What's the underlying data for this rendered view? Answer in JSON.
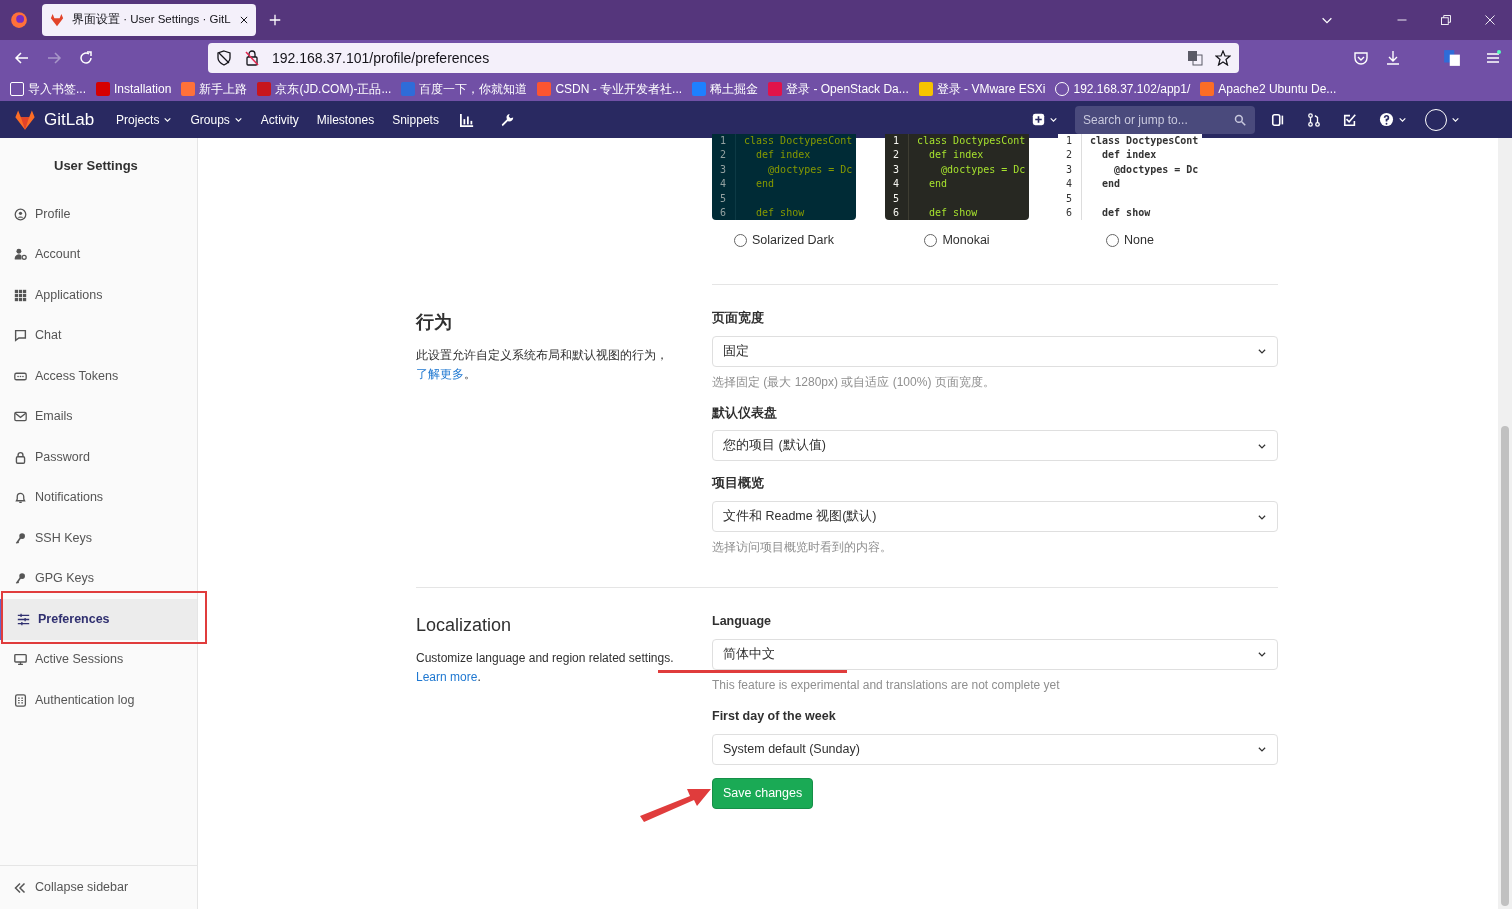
{
  "browser": {
    "tab_title": "界面设置 · User Settings · GitL",
    "url": "192.168.37.101/profile/preferences",
    "bookmarks": [
      {
        "label": "导入书签..."
      },
      {
        "label": "Installation"
      },
      {
        "label": "新手上路"
      },
      {
        "label": "京东(JD.COM)-正品..."
      },
      {
        "label": "百度一下，你就知道"
      },
      {
        "label": "CSDN - 专业开发者社..."
      },
      {
        "label": "稀土掘金"
      },
      {
        "label": "登录 - OpenStack Da..."
      },
      {
        "label": "登录 - VMware ESXi"
      },
      {
        "label": "192.168.37.102/app1/"
      },
      {
        "label": "Apache2 Ubuntu De..."
      }
    ]
  },
  "topnav": {
    "brand": "GitLab",
    "menu": [
      {
        "label": "Projects",
        "dropdown": true
      },
      {
        "label": "Groups",
        "dropdown": true
      },
      {
        "label": "Activity",
        "dropdown": false
      },
      {
        "label": "Milestones",
        "dropdown": false
      },
      {
        "label": "Snippets",
        "dropdown": false
      }
    ],
    "search_placeholder": "Search or jump to..."
  },
  "sidebar": {
    "title": "User Settings",
    "items": [
      {
        "label": "Profile",
        "selected": false
      },
      {
        "label": "Account",
        "selected": false
      },
      {
        "label": "Applications",
        "selected": false
      },
      {
        "label": "Chat",
        "selected": false
      },
      {
        "label": "Access Tokens",
        "selected": false
      },
      {
        "label": "Emails",
        "selected": false
      },
      {
        "label": "Password",
        "selected": false
      },
      {
        "label": "Notifications",
        "selected": false
      },
      {
        "label": "SSH Keys",
        "selected": false
      },
      {
        "label": "GPG Keys",
        "selected": false
      },
      {
        "label": "Preferences",
        "selected": true
      },
      {
        "label": "Active Sessions",
        "selected": false
      },
      {
        "label": "Authentication log",
        "selected": false
      }
    ],
    "collapse_label": "Collapse sidebar"
  },
  "syntax_themes": [
    {
      "name": "Solarized Dark",
      "kind": "solarized",
      "selected": false,
      "lines": [
        {
          "number": "1",
          "code": "class DoctypesCont"
        },
        {
          "number": "2",
          "code": "  def index"
        },
        {
          "number": "3",
          "code": "    @doctypes = Dc"
        },
        {
          "number": "4",
          "code": "  end"
        },
        {
          "number": "5"
        },
        {
          "number": "6",
          "code": "  def show"
        }
      ]
    },
    {
      "name": "Monokai",
      "kind": "monokai",
      "selected": false,
      "lines": [
        {
          "number": "1",
          "code": "class DoctypesCont"
        },
        {
          "number": "2",
          "code": "  def index"
        },
        {
          "number": "3",
          "code": "    @doctypes = Dc"
        },
        {
          "number": "4",
          "code": "  end"
        },
        {
          "number": "5"
        },
        {
          "number": "6",
          "code": "  def show"
        }
      ]
    },
    {
      "name": "None",
      "kind": "none",
      "selected": false,
      "lines": [
        {
          "number": "1",
          "code": "class DoctypesCont"
        },
        {
          "number": "2",
          "code": "  def index"
        },
        {
          "number": "3",
          "code": "    @doctypes = Dc"
        },
        {
          "number": "4",
          "code": "  end"
        },
        {
          "number": "5"
        },
        {
          "number": "6",
          "code": "  def show"
        }
      ]
    }
  ],
  "sections": [
    {
      "title": "行为",
      "description": "此设置允许自定义系统布局和默认视图的行为，",
      "link": "了解更多",
      "link_suffix": "。",
      "fields": [
        {
          "label": "页面宽度",
          "value": "固定",
          "help": "选择固定 (最大 1280px) 或自适应 (100%) 页面宽度。"
        },
        {
          "label": "默认仪表盘",
          "value": "您的项目 (默认值)"
        },
        {
          "label": "项目概览",
          "value": "文件和 Readme 视图(默认)",
          "help": "选择访问项目概览时看到的内容。"
        }
      ]
    },
    {
      "title": "Localization",
      "description": "Customize language and region related settings.",
      "link": "Learn more",
      "link_suffix": ".",
      "fields": [
        {
          "label": "Language",
          "value": "简体中文",
          "help": "This feature is experimental and translations are not complete yet"
        },
        {
          "label": "First day of the week",
          "value": "System default (Sunday)"
        }
      ]
    }
  ],
  "save_button": "Save changes"
}
